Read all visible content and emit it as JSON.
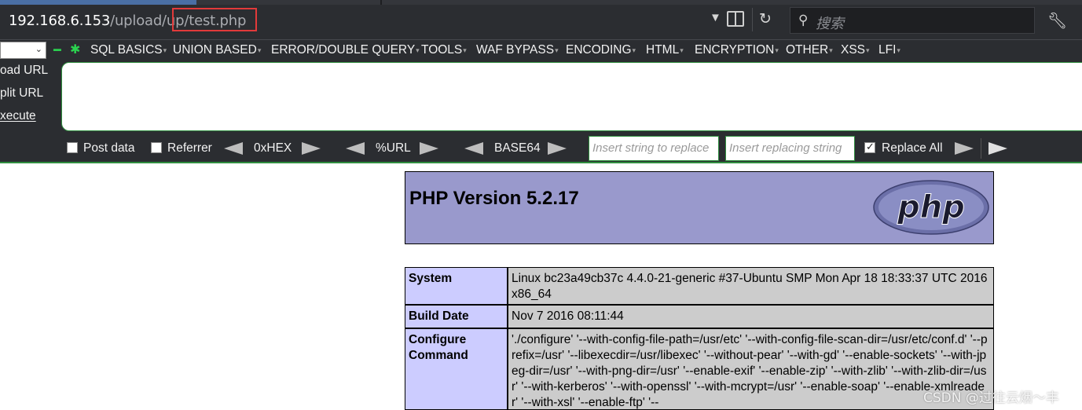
{
  "address_bar": {
    "url_host": "192.168.6.153",
    "url_path": "/upload/up/",
    "url_file": "test.php",
    "search_placeholder": "搜索",
    "highlight_color": "#e23a3a"
  },
  "hackbar": {
    "menus": [
      "SQL BASICS",
      "UNION BASED",
      "ERROR/DOUBLE QUERY",
      "TOOLS",
      "WAF BYPASS",
      "ENCODING",
      "HTML",
      "ENCRYPTION",
      "OTHER",
      "XSS",
      "LFI"
    ],
    "side_buttons": [
      "oad URL",
      "plit URL",
      "xecute"
    ],
    "post_data_label": "Post data",
    "referrer_label": "Referrer",
    "hex_label": "0xHEX",
    "url_label": "%URL",
    "base64_label": "BASE64",
    "replace_from_placeholder": "Insert string to replace",
    "replace_to_placeholder": "Insert replacing string",
    "replace_all_label": "Replace All",
    "replace_all_checked": true,
    "post_data_checked": false,
    "referrer_checked": false,
    "accent_color": "#2f8e3f"
  },
  "phpinfo": {
    "title": "PHP Version 5.2.17",
    "logo_text": "php",
    "rows": [
      {
        "key": "System",
        "value": "Linux bc23a49cb37c 4.4.0-21-generic #37-Ubuntu SMP Mon Apr 18 18:33:37 UTC 2016 x86_64"
      },
      {
        "key": "Build Date",
        "value": "Nov 7 2016 08:11:44"
      },
      {
        "key": "Configure Command",
        "value": "'./configure' '--with-config-file-path=/usr/etc' '--with-config-file-scan-dir=/usr/etc/conf.d' '--prefix=/usr' '--libexecdir=/usr/libexec' '--without-pear' '--with-gd' '--enable-sockets' '--with-jpeg-dir=/usr' '--with-png-dir=/usr' '--enable-exif' '--enable-zip' '--with-zlib' '--with-zlib-dir=/usr' '--with-kerberos' '--with-openssl' '--with-mcrypt=/usr' '--enable-soap' '--enable-xmlreader' '--with-xsl' '--enable-ftp' '--"
      }
    ]
  },
  "watermark": "CSDN @过往云烟～丰"
}
